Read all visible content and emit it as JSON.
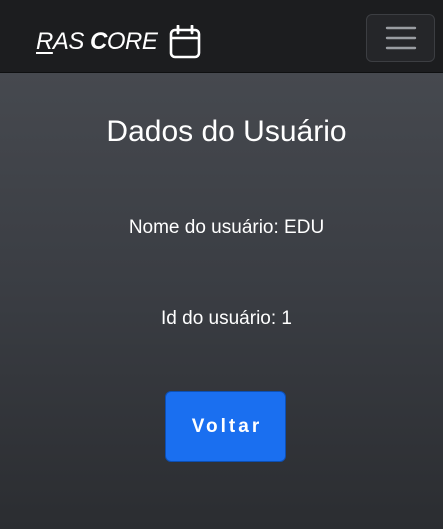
{
  "navbar": {
    "brand": {
      "part1_underlined": "R",
      "part2": "AS ",
      "part3_bold": "C",
      "part4": "ORE",
      "icon": "calendar-icon"
    },
    "menu_toggle_icon": "hamburger-menu-icon"
  },
  "main": {
    "title": "Dados do Usuário",
    "user_name_line": "Nome do usuário: EDU",
    "user_id_line": "Id do usuário: 1",
    "back_button_label": "Voltar"
  },
  "colors": {
    "navbar_bg": "#1c1d1f",
    "page_bg_top": "#4a4d53",
    "page_bg_bottom": "#2b2d31",
    "button_primary": "#1a6ff0",
    "text": "#ffffff"
  }
}
